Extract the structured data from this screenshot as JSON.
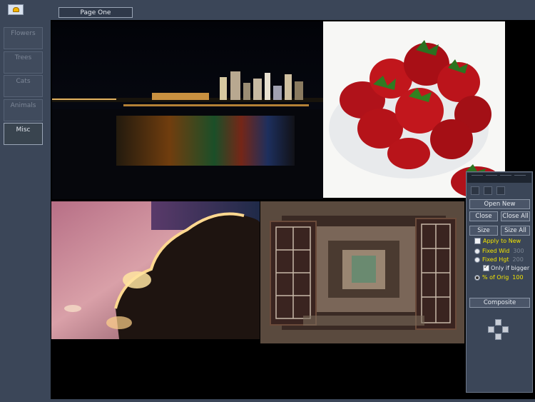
{
  "app": {
    "icon": "app-logo-icon"
  },
  "page_tab": {
    "label": "Page One"
  },
  "sidebar": {
    "items": [
      {
        "label": "Flowers",
        "active": false
      },
      {
        "label": "Trees",
        "active": false
      },
      {
        "label": "Cats",
        "active": false
      },
      {
        "label": "Animals",
        "active": false
      },
      {
        "label": "Misc",
        "active": true
      }
    ]
  },
  "photos": [
    {
      "name": "night-city-skyline"
    },
    {
      "name": "strawberries-bowl"
    },
    {
      "name": "sunset-clouds"
    },
    {
      "name": "nested-windows"
    }
  ],
  "panel": {
    "open_new": "Open New",
    "close": "Close",
    "close_all": "Close All",
    "size": "Size",
    "size_all": "Size All",
    "apply_to_new": "Apply to New",
    "fixed_wid": "Fixed Wid",
    "fixed_wid_value": "300",
    "fixed_hgt": "Fixed Hgt",
    "fixed_hgt_value": "200",
    "only_if_bigger": "Only if bigger",
    "pct_of_orig": "% of Orig",
    "pct_of_orig_value": "100",
    "composite": "Composite",
    "selected_mode": "% of Orig"
  },
  "colors": {
    "accent_text": "#f2e400",
    "background": "#3b4658",
    "canvas": "#000000"
  }
}
